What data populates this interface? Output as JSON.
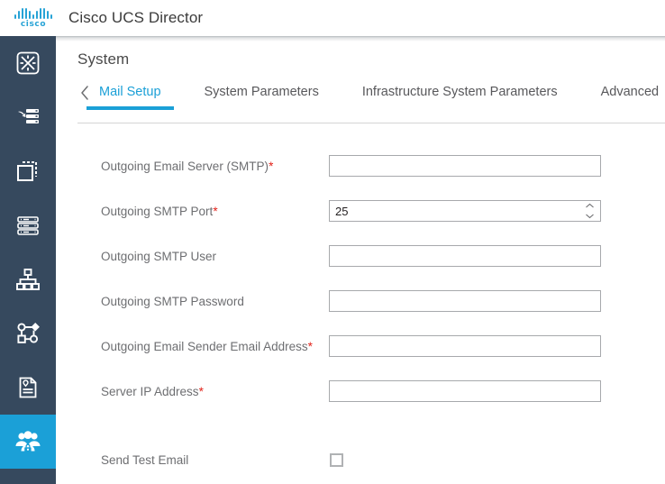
{
  "header": {
    "logo_word": "cisco",
    "logo_name": "cisco-logo",
    "title": "Cisco UCS Director"
  },
  "sidebar": {
    "items": [
      {
        "name": "converged-icon",
        "label": "Converged",
        "active": false
      },
      {
        "name": "virtual-resources-icon",
        "label": "Virtual Resources",
        "active": false
      },
      {
        "name": "physical-resources-icon",
        "label": "Physical Resources",
        "active": false
      },
      {
        "name": "servers-icon",
        "label": "Servers",
        "active": false
      },
      {
        "name": "organizations-icon",
        "label": "Organizations",
        "active": false
      },
      {
        "name": "policies-icon",
        "label": "Policies",
        "active": false
      },
      {
        "name": "reports-icon",
        "label": "Reports",
        "active": false
      },
      {
        "name": "administration-users-icon",
        "label": "Administration",
        "active": true
      }
    ]
  },
  "main": {
    "page_title": "System",
    "back_arrow": "chevron-left",
    "tabs": [
      {
        "label": "Mail Setup",
        "active": true
      },
      {
        "label": "System Parameters",
        "active": false
      },
      {
        "label": "Infrastructure System Parameters",
        "active": false
      },
      {
        "label": "Advanced",
        "active": false
      }
    ]
  },
  "form": {
    "fields": [
      {
        "label": "Outgoing Email Server (SMTP)",
        "required": true,
        "type": "text",
        "value": "",
        "placeholder": "",
        "name": "outgoing-email-server-smtp-input"
      },
      {
        "label": "Outgoing SMTP Port",
        "required": true,
        "type": "spinner",
        "value": "25",
        "placeholder": "",
        "name": "outgoing-smtp-port-input"
      },
      {
        "label": "Outgoing SMTP User",
        "required": false,
        "type": "text",
        "value": "",
        "placeholder": "",
        "name": "outgoing-smtp-user-input"
      },
      {
        "label": "Outgoing SMTP Password",
        "required": false,
        "type": "password",
        "value": "",
        "placeholder": "",
        "name": "outgoing-smtp-password-input"
      },
      {
        "label": "Outgoing Email Sender Email Address",
        "required": true,
        "type": "text",
        "value": "",
        "placeholder": "",
        "name": "outgoing-email-sender-address-input"
      },
      {
        "label": "Server IP Address",
        "required": true,
        "type": "text",
        "value": "",
        "placeholder": "",
        "name": "server-ip-address-input"
      },
      {
        "label": "Send Test Email",
        "required": false,
        "type": "checkbox",
        "checked": false,
        "name": "send-test-email-checkbox"
      }
    ],
    "required_marker": "*"
  },
  "colors": {
    "accent": "#1ba0d7",
    "sidebar_bg": "#36495e",
    "required_red": "#e2231a",
    "label_gray": "#6d6e71"
  }
}
